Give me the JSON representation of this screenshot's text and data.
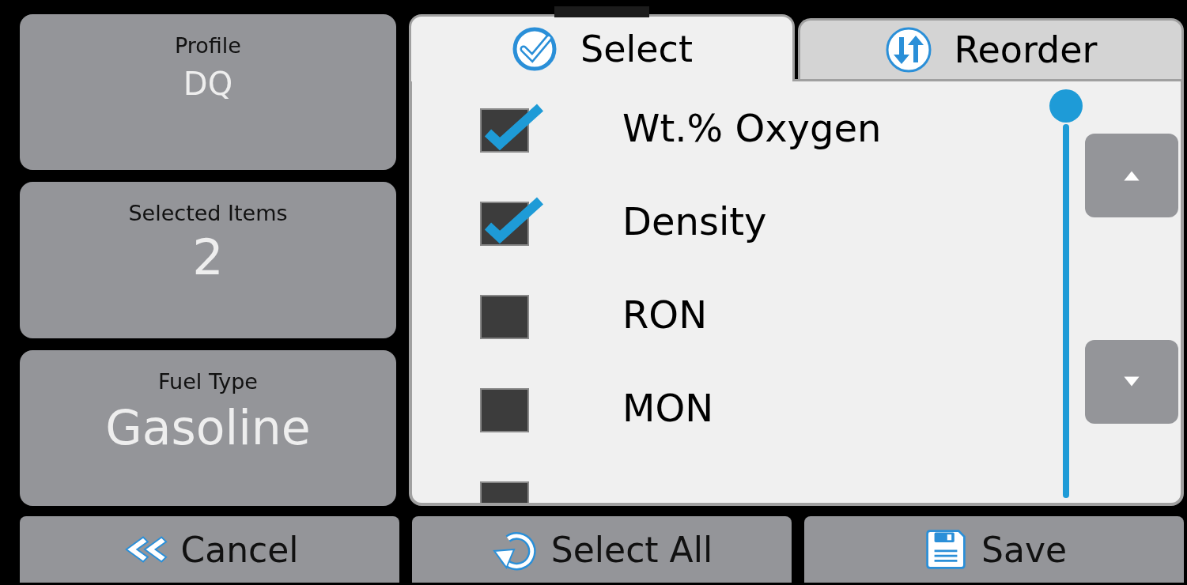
{
  "info_cards": [
    {
      "label": "Profile",
      "value": "DQ"
    },
    {
      "label": "Selected Items",
      "value": "2"
    },
    {
      "label": "Fuel Type",
      "value": "Gasoline"
    }
  ],
  "tabs": [
    {
      "label": "Select",
      "selected": true,
      "kind": "select"
    },
    {
      "label": "Reorder",
      "selected": false,
      "kind": "reorder"
    }
  ],
  "items": [
    {
      "label": "Wt.% Oxygen",
      "checked": true
    },
    {
      "label": "Density",
      "checked": true
    },
    {
      "label": "RON",
      "checked": false
    },
    {
      "label": "MON",
      "checked": false
    },
    {
      "checked": false
    }
  ],
  "buttons": [
    {
      "label": "Cancel",
      "kind": "back"
    },
    {
      "label": "Select All",
      "kind": "refresh"
    },
    {
      "label": "Save",
      "kind": "save"
    }
  ]
}
